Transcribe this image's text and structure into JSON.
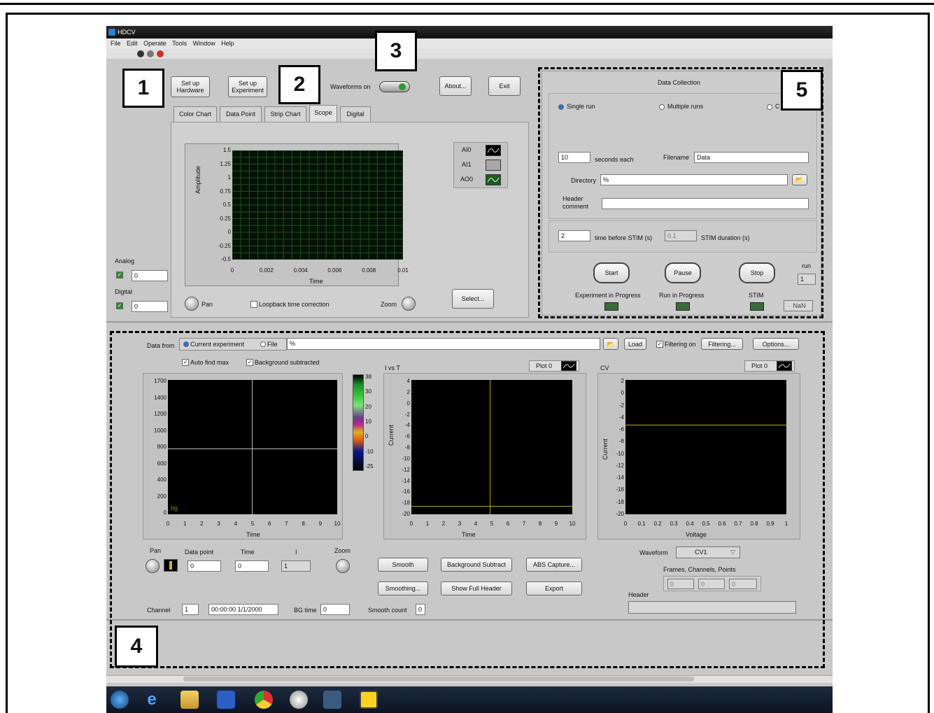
{
  "window": {
    "title": "HDCV"
  },
  "menu": [
    "File",
    "Edit",
    "Operate",
    "Tools",
    "Window",
    "Help"
  ],
  "top_buttons": {
    "setup_hardware": "Set up Hardware",
    "setup_experiment": "Set up Experiment",
    "waveforms_on": "Waveforms on",
    "about": "About...",
    "exit": "Exit"
  },
  "tabs": [
    "Color Chart",
    "Data Point",
    "Strip Chart",
    "Scope",
    "Digital"
  ],
  "active_tab": "Scope",
  "scope": {
    "ylabel": "Amplitude",
    "xlabel": "Time",
    "y_ticks": [
      "1.5",
      "1.25",
      "1",
      "0.75",
      "0.5",
      "0.25",
      "0",
      "-0.25",
      "-0.5"
    ],
    "x_ticks": [
      "0",
      "0.002",
      "0.004",
      "0.006",
      "0.008",
      "0.01"
    ],
    "legend": [
      "AI0",
      "AI1",
      "AO0"
    ],
    "pan": "Pan",
    "loopback": "Loopback time correction",
    "zoom": "Zoom",
    "select": "Select..."
  },
  "left_side": {
    "analog_label": "Analog",
    "analog_value": "0",
    "digital_label": "Digital",
    "digital_value": "0"
  },
  "data_collection": {
    "title": "Data Collection",
    "radios": [
      "Single run",
      "Multiple runs",
      "C"
    ],
    "seconds_value": "10",
    "seconds_label": "seconds each",
    "filename_label": "Filename",
    "filename_value": "Data",
    "directory_label": "Directory",
    "directory_value": "%",
    "header_label": "Header comment",
    "time_before_value": "2",
    "time_before_label": "time before STIM (s)",
    "stim_dur_value": "0.1",
    "stim_dur_label": "STIM duration (s)",
    "start": "Start",
    "pause": "Pause",
    "stop": "Stop",
    "run_label": "run",
    "run_value": "1",
    "exp_progress": "Experiment in Progress",
    "run_progress": "Run in Progress",
    "stim": "STIM",
    "nan": "NaN"
  },
  "analysis": {
    "data_from": "Data from",
    "current_experiment": "Current experiment",
    "file": "File",
    "path_value": "%",
    "load": "Load",
    "filtering_on": "Filtering on",
    "filtering": "Filtering...",
    "options": "Options...",
    "auto_find_max": "Auto find max",
    "background_subtracted": "Background subtracted",
    "color_plot": {
      "xlabel": "Time",
      "y_ticks": [
        "1700",
        "1400",
        "1200",
        "1000",
        "800",
        "600",
        "400",
        "200",
        "0"
      ],
      "x_ticks": [
        "0",
        "1",
        "2",
        "3",
        "4",
        "5",
        "6",
        "7",
        "8",
        "9",
        "10"
      ],
      "bg": "bg",
      "scale_ticks": [
        "38",
        "30",
        "20",
        "10",
        "0",
        "-10",
        "-25"
      ]
    },
    "ivst": {
      "title": "I vs T",
      "plot_legend": "Plot 0",
      "ylabel": "Current",
      "xlabel": "Time",
      "y_ticks": [
        "4",
        "2",
        "0",
        "-2",
        "-4",
        "-6",
        "-8",
        "-10",
        "-12",
        "-14",
        "-16",
        "-18",
        "-20"
      ],
      "x_ticks": [
        "0",
        "1",
        "2",
        "3",
        "4",
        "5",
        "6",
        "7",
        "8",
        "9",
        "10"
      ]
    },
    "cv": {
      "title": "CV",
      "plot_legend": "Plot 0",
      "ylabel": "Current",
      "xlabel": "Voltage",
      "y_ticks": [
        "2",
        "0",
        "-2",
        "-4",
        "-6",
        "-8",
        "-10",
        "-12",
        "-14",
        "-16",
        "-18",
        "-20"
      ],
      "x_ticks": [
        "0",
        "0.1",
        "0.2",
        "0.3",
        "0.4",
        "0.5",
        "0.6",
        "0.7",
        "0.8",
        "0.9",
        "1"
      ]
    },
    "pan": "Pan",
    "data_point": "Data point",
    "data_point_value": "0",
    "time": "Time",
    "time_value": "0",
    "i_label": "I",
    "i_value": "1",
    "zoom": "Zoom",
    "smooth": "Smooth",
    "smoothing": "Smoothing...",
    "background_subtract": "Background Subtract",
    "show_full_header": "Show Full Header",
    "abs_capture": "ABS Capture...",
    "export": "Export",
    "waveform_label": "Waveform",
    "waveform_value": "CV1",
    "frames_label": "Frames, Channels, Points",
    "frames_values": [
      "0",
      "0",
      "0"
    ],
    "header_label": "Header",
    "channel_label": "Channel",
    "channel_value": "1",
    "datetime_value": "00:00:00 1/1/2000",
    "bg_time_label": "BG time",
    "bg_time_value": "0",
    "smooth_count_label": "Smooth count",
    "smooth_count_value": "0"
  },
  "callouts": [
    "1",
    "2",
    "3",
    "4",
    "5"
  ],
  "colors": {
    "plot_bg": "#000000",
    "grid_green": "#1f4f1f",
    "trace": "#b9a23a",
    "crosshair": "#c8c8c8"
  }
}
